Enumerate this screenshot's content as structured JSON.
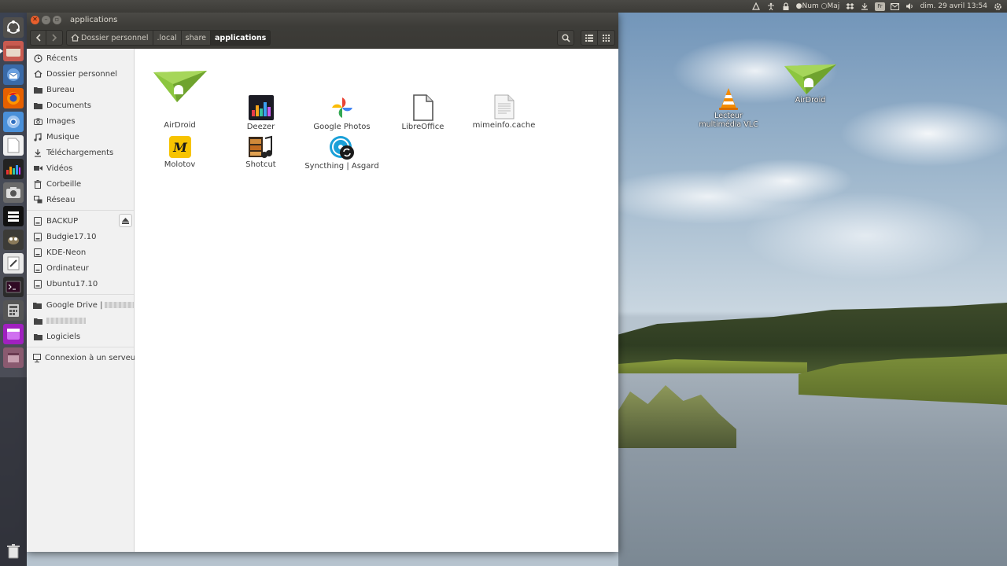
{
  "top_panel": {
    "num": "Num",
    "maj": "Maj",
    "keyboard_layout": "Fr",
    "clock": "dim. 29 avril 13:54"
  },
  "window": {
    "title": "applications",
    "breadcrumbs": [
      "Dossier personnel",
      ".local",
      "share",
      "applications"
    ]
  },
  "sidebar": {
    "places": [
      "Récents",
      "Dossier personnel",
      "Bureau",
      "Documents",
      "Images",
      "Musique",
      "Téléchargements",
      "Vidéos",
      "Corbeille",
      "Réseau"
    ],
    "devices": [
      "BACKUP",
      "Budgie17.10",
      "KDE-Neon",
      "Ordinateur",
      "Ubuntu17.10"
    ],
    "bookmarks": [
      "Google Drive |",
      "Logiciels"
    ],
    "connect_server": "Connexion à un serveur"
  },
  "files": [
    "AirDroid",
    "Deezer",
    "Google Photos",
    "LibreOffice",
    "mimeinfo.cache",
    "Molotov",
    "Shotcut",
    "Syncthing | Asgard"
  ],
  "desktop_icons": {
    "vlc_line1": "Lecteur",
    "vlc_line2": "multimédia VLC",
    "airdroid": "AirDroid"
  },
  "colors": {
    "ubuntu_dark": "#3c3b37",
    "close_orange": "#e95f2c",
    "airdroid_green": "#8cc63f"
  }
}
